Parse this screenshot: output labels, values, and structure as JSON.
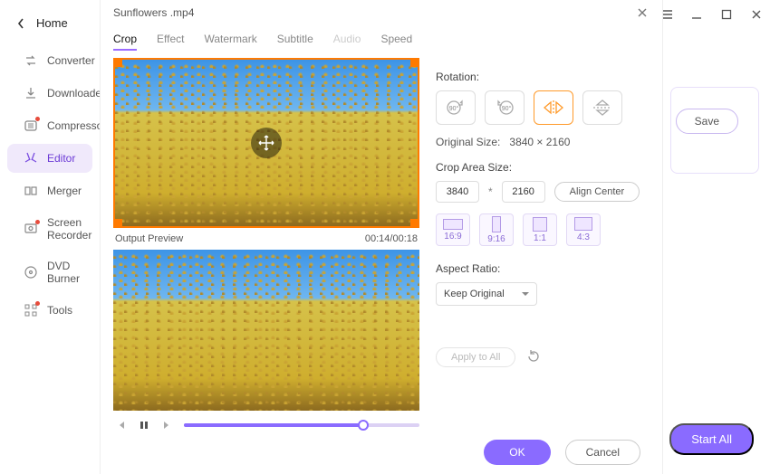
{
  "window": {
    "title": "Sunflowers .mp4"
  },
  "sidebar": {
    "home": "Home",
    "items": [
      {
        "label": "Converter"
      },
      {
        "label": "Downloader"
      },
      {
        "label": "Compressor"
      },
      {
        "label": "Editor"
      },
      {
        "label": "Merger"
      },
      {
        "label": "Screen Recorder"
      },
      {
        "label": "DVD Burner"
      },
      {
        "label": "Tools"
      }
    ]
  },
  "tabs": {
    "crop": "Crop",
    "effect": "Effect",
    "watermark": "Watermark",
    "subtitle": "Subtitle",
    "audio": "Audio",
    "speed": "Speed"
  },
  "preview": {
    "output_label": "Output Preview",
    "time": "00:14/00:18"
  },
  "controls": {
    "rotation_label": "Rotation:",
    "rotate_cw": "90°",
    "rotate_ccw": "90°",
    "original_size_label": "Original Size:",
    "original_size_value": "3840 × 2160",
    "crop_area_label": "Crop Area Size:",
    "crop_w": "3840",
    "crop_h": "2160",
    "align_center": "Align Center",
    "ratios": {
      "r169": "16:9",
      "r916": "9:16",
      "r11": "1:1",
      "r43": "4:3"
    },
    "aspect_label": "Aspect Ratio:",
    "aspect_value": "Keep Original",
    "apply_all": "Apply to All"
  },
  "footer": {
    "ok": "OK",
    "cancel": "Cancel"
  },
  "bg": {
    "save": "Save",
    "start_all": "Start All"
  }
}
